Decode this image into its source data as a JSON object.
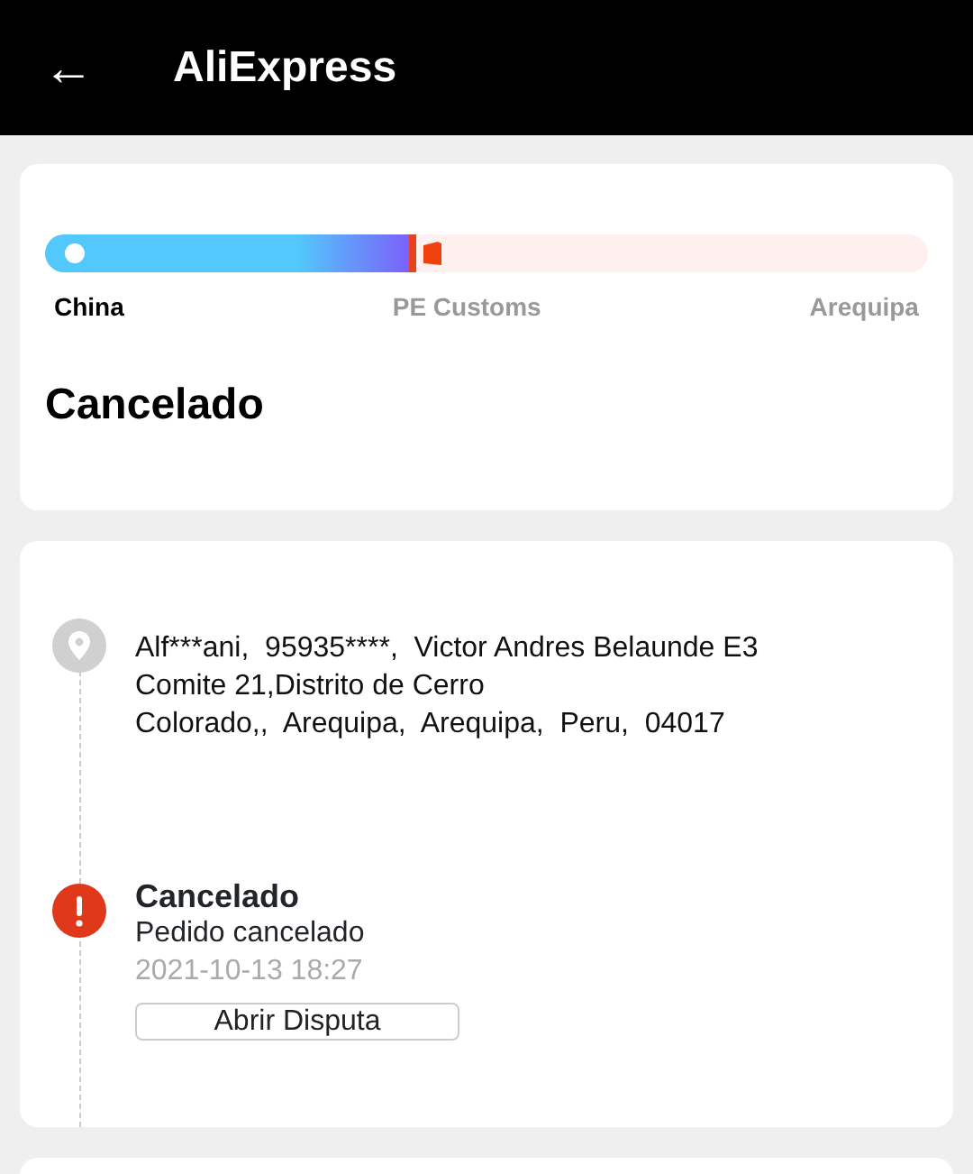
{
  "header": {
    "back": "←",
    "title": "AliExpress"
  },
  "progress": {
    "level": 0.42,
    "stops": [
      {
        "label": "China",
        "reached": true
      },
      {
        "label": "PE Customs",
        "reached": false
      },
      {
        "label": "Arequipa",
        "reached": false
      }
    ],
    "status": "Cancelado"
  },
  "timeline": [
    {
      "kind": "address",
      "lines": [
        "Alf***ani,  95935****,  Victor Andres Belaunde E3",
        "Comite 21,Distrito de Cerro",
        "Colorado,,  Arequipa,  Arequipa,  Peru,  04017"
      ]
    },
    {
      "kind": "event",
      "title": "Cancelado",
      "text": "Pedido cancelado",
      "time": "2021-10-13 18:27",
      "button": "Abrir Disputa"
    }
  ]
}
